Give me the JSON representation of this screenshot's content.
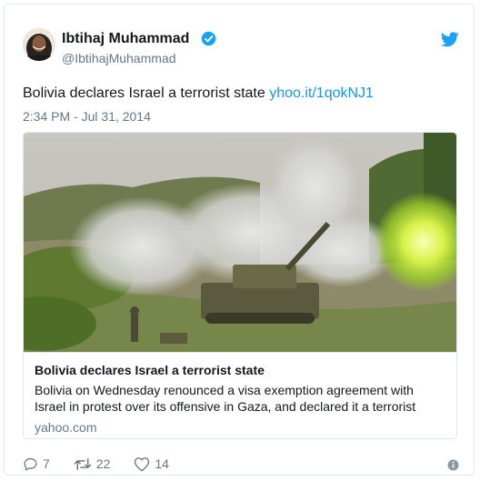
{
  "tweet": {
    "author": {
      "display_name": "Ibtihaj Muhammad",
      "handle": "@IbtihajMuhammad",
      "verified": true,
      "avatar_icon": "avatar-photo"
    },
    "text": "Bolivia declares Israel a terrorist state ",
    "link": "yhoo.it/1qokNJ1",
    "timestamp": "2:34 PM - Jul 31, 2014",
    "colors": {
      "link": "#1b95e0",
      "verified": "#1da1f2",
      "twitter_brand": "#1da1f2",
      "secondary_text": "#657786"
    },
    "card": {
      "image_icon": "tank-firing-photo",
      "title": "Bolivia declares Israel a terrorist state",
      "description_line1": "Bolivia on Wednesday renounced a visa exemption agreement with",
      "description_line2": "Israel in protest over its offensive in Gaza, and declared it a terrorist",
      "domain": "yahoo.com"
    },
    "actions": {
      "replies": "7",
      "retweets": "22",
      "likes": "14"
    }
  }
}
